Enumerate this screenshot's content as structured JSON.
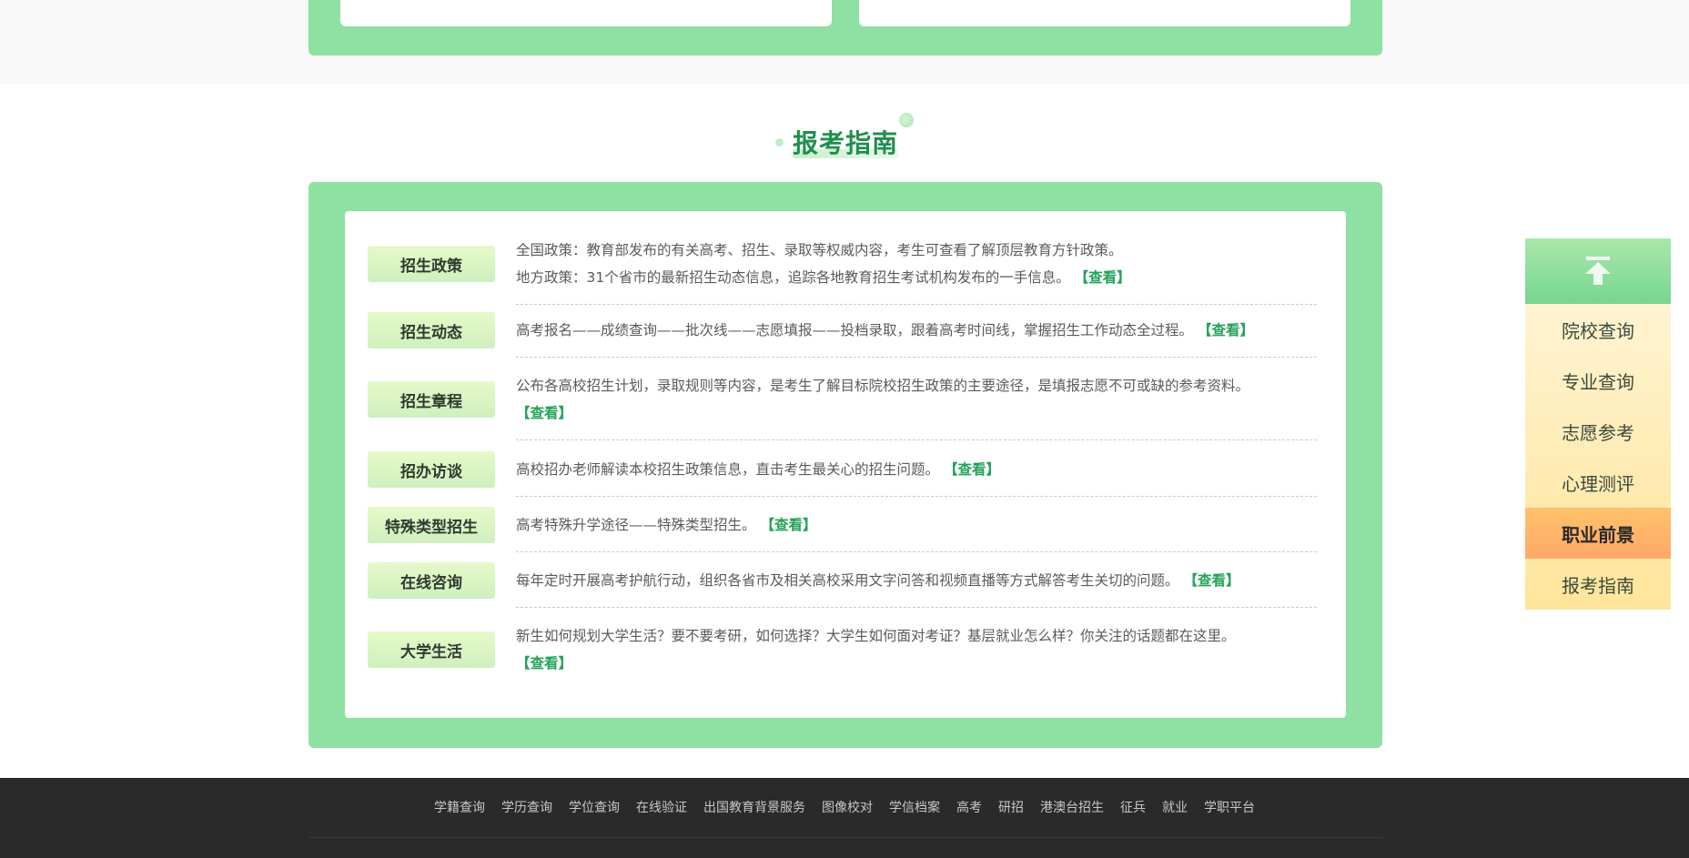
{
  "section": {
    "title": "报考指南"
  },
  "guide": {
    "view_label": "【查看】",
    "rows": [
      {
        "label": "招生政策",
        "lines": [
          "全国政策：教育部发布的有关高考、招生、录取等权威内容，考生可查看了解顶层教育方针政策。",
          "地方政策：31个省市的最新招生动态信息，追踪各地教育招生考试机构发布的一手信息。"
        ]
      },
      {
        "label": "招生动态",
        "lines": [
          "高考报名——成绩查询——批次线——志愿填报——投档录取，跟着高考时间线，掌握招生工作动态全过程。"
        ]
      },
      {
        "label": "招生章程",
        "lines": [
          "公布各高校招生计划，录取规则等内容，是考生了解目标院校招生政策的主要途径，是填报志愿不可或缺的参考资料。"
        ]
      },
      {
        "label": "招办访谈",
        "lines": [
          "高校招办老师解读本校招生政策信息，直击考生最关心的招生问题。"
        ]
      },
      {
        "label": "特殊类型招生",
        "lines": [
          "高考特殊升学途径——特殊类型招生。"
        ]
      },
      {
        "label": "在线咨询",
        "lines": [
          "每年定时开展高考护航行动，组织各省市及相关高校采用文字问答和视频直播等方式解答考生关切的问题。"
        ]
      },
      {
        "label": "大学生活",
        "lines": [
          "新生如何规划大学生活？要不要考研，如何选择？大学生如何面对考证？基层就业怎么样？你关注的话题都在这里。"
        ]
      }
    ]
  },
  "side_nav": {
    "top_icon": "arrow-up-icon",
    "items": [
      "院校查询",
      "专业查询",
      "志愿参考",
      "心理测评",
      "职业前景",
      "报考指南"
    ],
    "active_index": 4
  },
  "footer": {
    "links": [
      "学籍查询",
      "学历查询",
      "学位查询",
      "在线验证",
      "出国教育背景服务",
      "图像校对",
      "学信档案",
      "高考",
      "研招",
      "港澳台招生",
      "征兵",
      "就业",
      "学职平台"
    ]
  },
  "colors": {
    "panel_green": "#8fe0a3",
    "link_green": "#26a35a",
    "title_green": "#1f8f4e",
    "footer_bg": "#2a2a2a",
    "active_orange": "#ffb36a"
  }
}
